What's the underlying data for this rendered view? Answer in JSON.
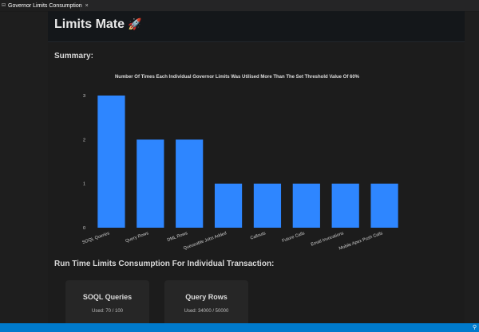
{
  "tab": {
    "label": "Governor Limits Consumption",
    "icon": "preview-icon",
    "close": "×"
  },
  "header": {
    "title": "Limits Mate",
    "emoji": "🚀"
  },
  "summary": {
    "heading": "Summary:"
  },
  "chart_data": {
    "type": "bar",
    "title": "Number Of Times Each Individual Governor Limits Was Utilised More Than The Set Threshold Value Of 60%",
    "categories": [
      "SOQL Queries",
      "Query Rows",
      "DML Rows",
      "Queueable Jobs Added",
      "Callouts",
      "Future Calls",
      "Email Invocations",
      "Mobile Apex Push Calls"
    ],
    "values": [
      3,
      2,
      2,
      1,
      1,
      1,
      1,
      1
    ],
    "ylim": [
      0,
      3
    ],
    "yticks": [
      0,
      1,
      2,
      3
    ],
    "xlabel": "",
    "ylabel": "",
    "color": "#2e86ff",
    "grid": false
  },
  "runtime": {
    "heading": "Run Time Limits Consumption For Individual Transaction:",
    "cards": [
      {
        "title": "SOQL Queries",
        "used": "Used: 70 / 100"
      },
      {
        "title": "Query Rows",
        "used": "Used: 34000 / 50000"
      }
    ]
  },
  "statusbar": {
    "right_icon": "bell-icon"
  }
}
